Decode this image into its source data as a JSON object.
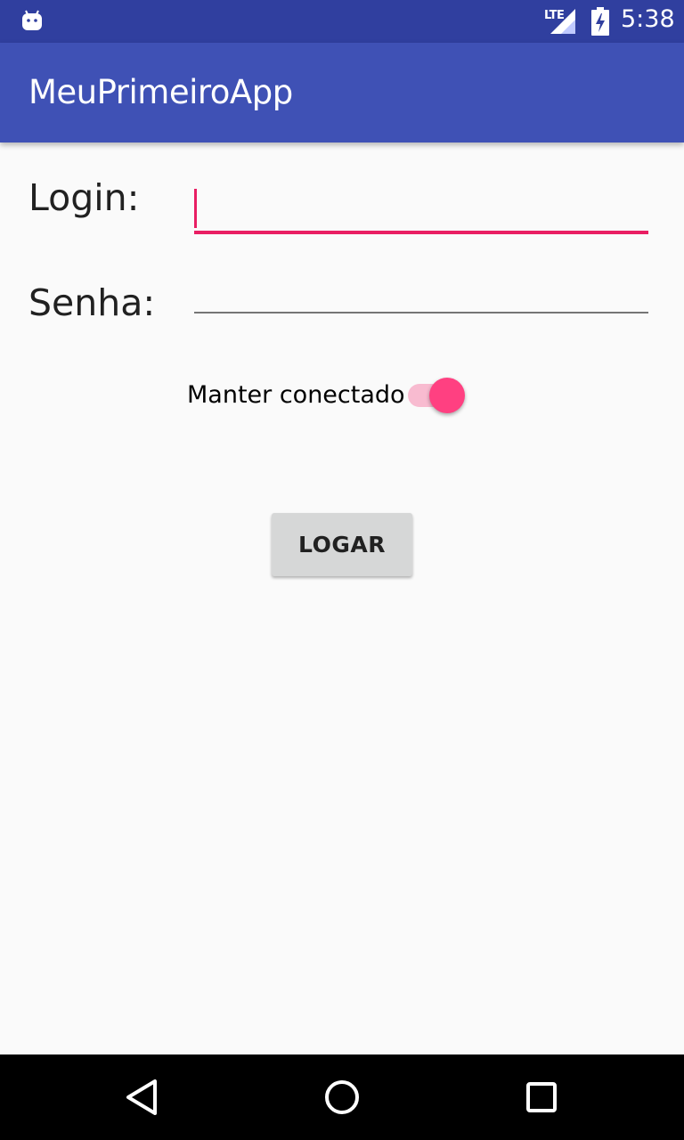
{
  "status_bar": {
    "network": "LTE",
    "time": "5:38",
    "icons": [
      "android-icon",
      "lte-signal-icon",
      "battery-charging-icon"
    ],
    "background_color": "#303f9f"
  },
  "app_bar": {
    "title": "MeuPrimeiroApp",
    "background_color": "#3f51b5"
  },
  "form": {
    "login_label": "Login:",
    "login_value": "",
    "senha_label": "Senha:",
    "senha_value": "",
    "keep_connected_label": "Manter conectado",
    "keep_connected_on": true,
    "submit_label": "LOGAR",
    "accent_color": "#ff4081"
  },
  "nav_bar": {
    "icons": [
      "back-icon",
      "home-icon",
      "recents-icon"
    ]
  }
}
